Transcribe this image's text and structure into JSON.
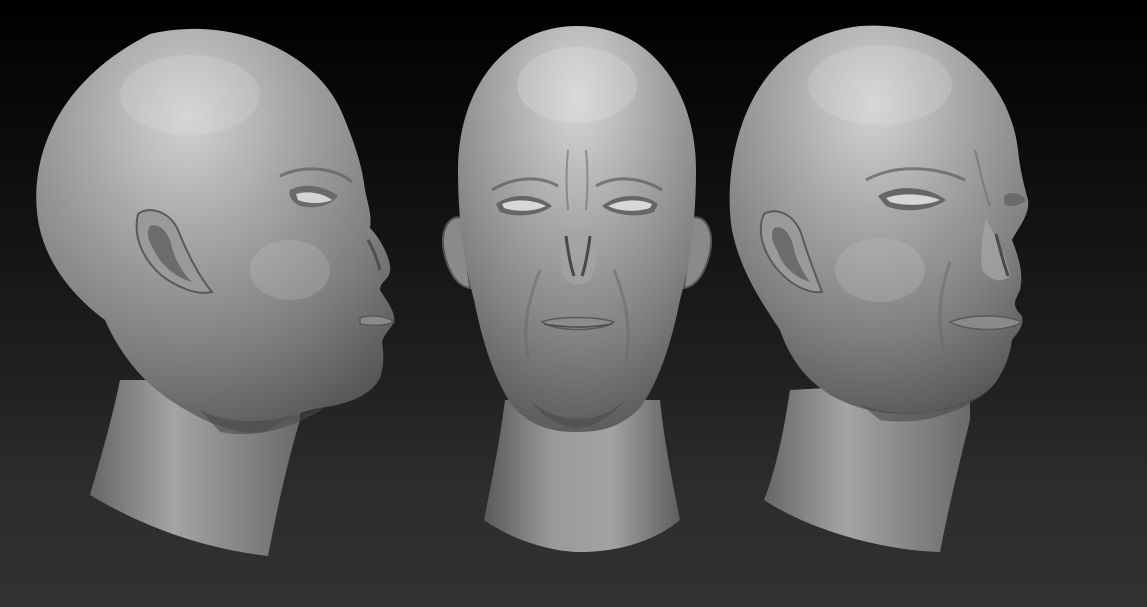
{
  "scene": {
    "background_top_color": "#000000",
    "background_bottom_color": "#323232",
    "material_color": "#8c8c8c",
    "views": [
      {
        "name": "side-profile",
        "facing": "right"
      },
      {
        "name": "front",
        "facing": "viewer"
      },
      {
        "name": "three-quarter",
        "facing": "right"
      }
    ]
  }
}
